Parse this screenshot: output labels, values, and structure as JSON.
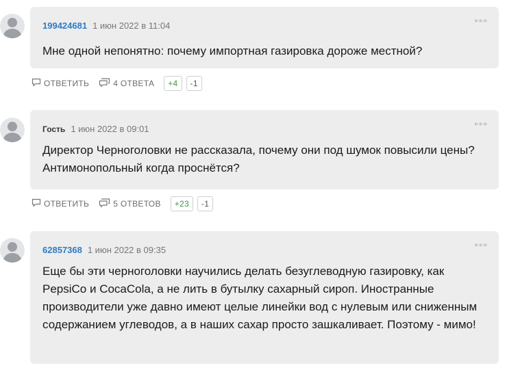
{
  "comments": [
    {
      "author": "199424681",
      "date": "1 июн 2022 в 11:04",
      "text": "Мне одной непонятно: почему импортная газировка дороже местной?",
      "reply_label": "ОТВЕТИТЬ",
      "answers_label": "4 ОТВЕТА",
      "upvotes": "+4",
      "downvotes": "-1",
      "menu": "°°°"
    },
    {
      "author": "Гость",
      "date": "1 июн 2022 в 09:01",
      "text": "Директор Черноголовки не рассказала, почему они под шумок повысили цены? Антимонопольный когда проснётся?",
      "reply_label": "ОТВЕТИТЬ",
      "answers_label": "5 ОТВЕТОВ",
      "upvotes": "+23",
      "downvotes": "-1",
      "menu": "°°°"
    },
    {
      "author": "62857368",
      "date": "1 июн 2022 в 09:35",
      "text": "Еще бы эти черноголовки научились делать безуглеводную газировку, как PepsiCo и CocaCola, а не лить в бутылку сахарный сироп. Иностранные производители уже давно имеют целые линейки вод с нулевым или сниженным содержанием углеводов, а в наших сахар просто зашкаливает. Поэтому - мимо!",
      "menu": "°°°"
    }
  ],
  "icons": {
    "avatar": "user-silhouette-icon",
    "reply": "comment-icon",
    "answers": "comments-icon",
    "menu": "more-dots-icon"
  },
  "colors": {
    "bubble": "#ededed",
    "author_link": "#2c7cc6",
    "upvote": "#3a9a3a"
  }
}
